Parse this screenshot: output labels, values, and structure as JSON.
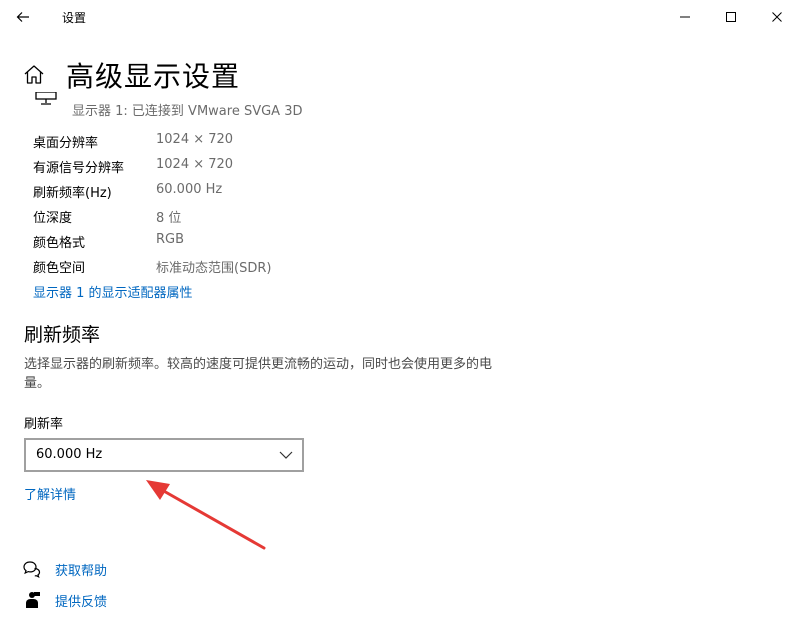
{
  "window": {
    "title": "设置"
  },
  "header": {
    "page_title": "高级显示设置"
  },
  "display": {
    "selected": "显示器 1: 已连接到 VMware SVGA 3D"
  },
  "info": [
    {
      "label": "桌面分辨率",
      "value": "1024 × 720"
    },
    {
      "label": "有源信号分辨率",
      "value": "1024 × 720"
    },
    {
      "label": "刷新频率(Hz)",
      "value": "60.000 Hz"
    },
    {
      "label": "位深度",
      "value": "8 位"
    },
    {
      "label": "颜色格式",
      "value": "RGB"
    },
    {
      "label": "颜色空间",
      "value": "标准动态范围(SDR)"
    }
  ],
  "adapter_link": "显示器 1 的显示适配器属性",
  "refresh": {
    "title": "刷新频率",
    "description": "选择显示器的刷新频率。较高的速度可提供更流畅的运动，同时也会使用更多的电量。",
    "label": "刷新率",
    "selected_value": "60.000 Hz",
    "learn_more": "了解详情"
  },
  "footer": {
    "help": "获取帮助",
    "feedback": "提供反馈"
  },
  "colors": {
    "link": "#0067c0",
    "annotation_arrow": "#e53935"
  },
  "icons": {
    "back": "back-arrow-icon",
    "minimize": "minimize-icon",
    "maximize": "maximize-icon",
    "close": "close-icon",
    "home": "home-icon",
    "monitor": "monitor-icon",
    "chevron": "chevron-down-icon",
    "help": "help-chat-icon",
    "feedback": "feedback-icon"
  }
}
